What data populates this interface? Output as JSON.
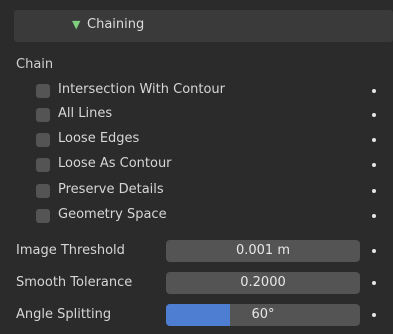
{
  "panel": {
    "title": "Chaining",
    "expanded": true,
    "accent": "#7fd07f"
  },
  "chain": {
    "label": "Chain",
    "options": [
      {
        "label": "Intersection With Contour",
        "checked": false
      },
      {
        "label": "All Lines",
        "checked": false
      },
      {
        "label": "Loose Edges",
        "checked": false
      },
      {
        "label": "Loose As Contour",
        "checked": false
      },
      {
        "label": "Preserve Details",
        "checked": false
      },
      {
        "label": "Geometry Space",
        "checked": false
      }
    ]
  },
  "properties": {
    "image_threshold": {
      "label": "Image Threshold",
      "value": "0.001 m"
    },
    "smooth_tolerance": {
      "label": "Smooth Tolerance",
      "value": "0.2000"
    },
    "angle_splitting": {
      "label": "Angle Splitting",
      "value": "60°",
      "fill_fraction": 0.33,
      "fill_color": "#4d7ed1"
    }
  }
}
